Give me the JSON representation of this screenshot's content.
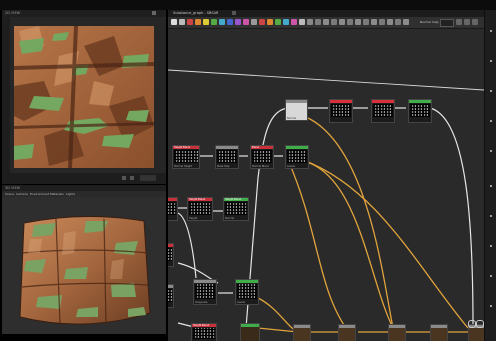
{
  "window": {
    "title": "Substance_graph - SBSAR"
  },
  "viewport2d": {
    "label": "2D VIEW"
  },
  "viewport3d": {
    "label": "3D VIEW",
    "menu": [
      {
        "label": "Scene"
      },
      {
        "label": "Camera"
      },
      {
        "label": "Environment"
      },
      {
        "label": "Materials"
      },
      {
        "label": "Lights"
      }
    ],
    "zoom_readout": "100.00%"
  },
  "graph": {
    "view_label": "Normal map"
  },
  "nodes": [
    {
      "id": "n1",
      "header": "#8a8a8a",
      "title": "",
      "label": "Normal"
    },
    {
      "id": "n2",
      "header": "#d7303a",
      "title": "",
      "label": ""
    },
    {
      "id": "n3",
      "header": "#d7303a",
      "title": "",
      "label": ""
    },
    {
      "id": "n4",
      "header": "#3fae4a",
      "title": "",
      "label": ""
    },
    {
      "id": "n5",
      "header": "#c8303a",
      "title": "Height Blend",
      "label": "Normal Height"
    },
    {
      "id": "n6",
      "header": "#8a8a8a",
      "title": "",
      "label": "Mask Map"
    },
    {
      "id": "n7",
      "header": "#c8303a",
      "title": "Blend",
      "label": "Normal Blend"
    },
    {
      "id": "n8",
      "header": "#3fae4a",
      "title": "",
      "label": "Levels"
    },
    {
      "id": "n9",
      "header": "#c8303a",
      "title": "Height Blend",
      "label": "Height"
    },
    {
      "id": "n10",
      "header": "#3fae4a",
      "title": "Height Blend",
      "label": "Normal"
    },
    {
      "id": "n11",
      "header": "#8a8a8a",
      "title": "",
      "label": "Grayscale"
    },
    {
      "id": "n12",
      "header": "#3fae4a",
      "title": "",
      "label": "Levels"
    },
    {
      "id": "n13",
      "header": "#c8303a",
      "title": "Height Blend",
      "label": "Transform"
    },
    {
      "id": "n14",
      "header": "#3fae4a",
      "title": "",
      "label": ""
    },
    {
      "id": "n15",
      "header": "#8a8a8a",
      "title": "",
      "label": ""
    },
    {
      "id": "n16",
      "header": "#8a8a8a",
      "title": "",
      "label": ""
    },
    {
      "id": "n17",
      "header": "#8a8a8a",
      "title": "",
      "label": ""
    },
    {
      "id": "n18",
      "header": "#8a8a8a",
      "title": "",
      "label": ""
    },
    {
      "id": "n19",
      "header": "#8a8a8a",
      "title": "",
      "label": ""
    }
  ],
  "colors": {
    "wire_white": "#e6e6e6",
    "wire_orange": "#e2a43c",
    "graph_bg": "#2a2a2a",
    "node_red": "#d7303a",
    "node_green": "#3fae4a"
  }
}
